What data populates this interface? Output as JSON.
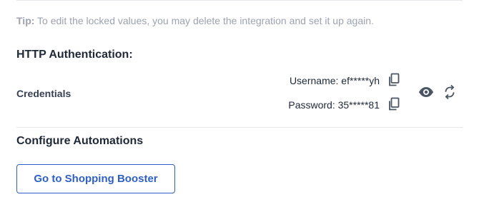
{
  "tip": {
    "label": "Tip:",
    "text": " To edit the locked values, you may delete the integration and set it up again."
  },
  "http_auth": {
    "heading": "HTTP Authentication:",
    "credentials_label": "Credentials",
    "username_line": "Username: ef*****yh",
    "password_line": "Password: 35*****81",
    "icons": {
      "copy_username": "copy-icon",
      "copy_password": "copy-icon",
      "reveal": "eye-icon",
      "refresh": "sync-icon"
    }
  },
  "automations": {
    "heading": "Configure Automations",
    "button_label": "Go to Shopping Booster"
  },
  "colors": {
    "text_primary": "#1f2937",
    "text_muted": "#9ca3af",
    "accent_blue": "#2f5fc4",
    "divider": "#e5e7eb",
    "icon": "#4b5563"
  }
}
